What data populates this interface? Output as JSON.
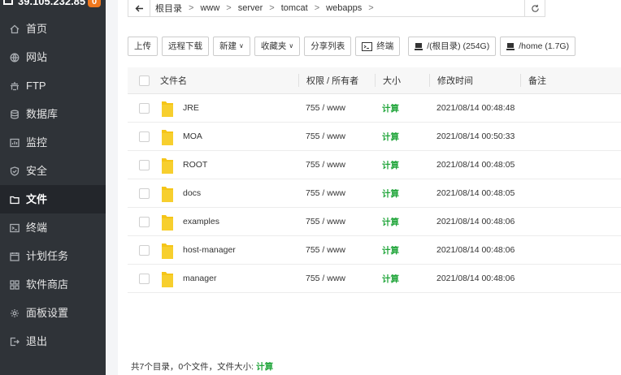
{
  "server": {
    "ip": "39.105.232.85",
    "badge": "0"
  },
  "nav": [
    {
      "label": "首页",
      "icon": "home-icon"
    },
    {
      "label": "网站",
      "icon": "globe-icon"
    },
    {
      "label": "FTP",
      "icon": "ftp-icon"
    },
    {
      "label": "数据库",
      "icon": "database-icon"
    },
    {
      "label": "监控",
      "icon": "monitor-icon"
    },
    {
      "label": "安全",
      "icon": "shield-icon"
    },
    {
      "label": "文件",
      "icon": "folder-icon",
      "active": true
    },
    {
      "label": "终端",
      "icon": "terminal-icon"
    },
    {
      "label": "计划任务",
      "icon": "calendar-icon"
    },
    {
      "label": "软件商店",
      "icon": "grid-icon"
    },
    {
      "label": "面板设置",
      "icon": "gear-icon"
    },
    {
      "label": "退出",
      "icon": "logout-icon"
    }
  ],
  "path": {
    "segments": [
      "根目录",
      "www",
      "server",
      "tomcat",
      "webapps"
    ]
  },
  "toolbar": {
    "upload": "上传",
    "remote_download": "远程下载",
    "new": "新建",
    "favorites": "收藏夹",
    "share_list": "分享列表",
    "terminal": "终端",
    "disk_root": "/(根目录) (254G)",
    "disk_home": "/home (1.7G)"
  },
  "table": {
    "headers": {
      "name": "文件名",
      "perm": "权限 / 所有者",
      "size": "大小",
      "time": "修改时间",
      "note": "备注"
    },
    "rows": [
      {
        "name": "JRE",
        "perm": "755 / www",
        "size": "计算",
        "time": "2021/08/14 00:48:48"
      },
      {
        "name": "MOA",
        "perm": "755 / www",
        "size": "计算",
        "time": "2021/08/14 00:50:33"
      },
      {
        "name": "ROOT",
        "perm": "755 / www",
        "size": "计算",
        "time": "2021/08/14 00:48:05"
      },
      {
        "name": "docs",
        "perm": "755 / www",
        "size": "计算",
        "time": "2021/08/14 00:48:05"
      },
      {
        "name": "examples",
        "perm": "755 / www",
        "size": "计算",
        "time": "2021/08/14 00:48:06"
      },
      {
        "name": "host-manager",
        "perm": "755 / www",
        "size": "计算",
        "time": "2021/08/14 00:48:06"
      },
      {
        "name": "manager",
        "perm": "755 / www",
        "size": "计算",
        "time": "2021/08/14 00:48:06"
      }
    ]
  },
  "footer": {
    "summary": "共7个目录，0个文件，文件大小:",
    "calc": "计算"
  },
  "colors": {
    "sidebar": "#2f3338",
    "accent_green": "#20a53a",
    "badge": "#f0781e",
    "folder": "#f5c518"
  }
}
